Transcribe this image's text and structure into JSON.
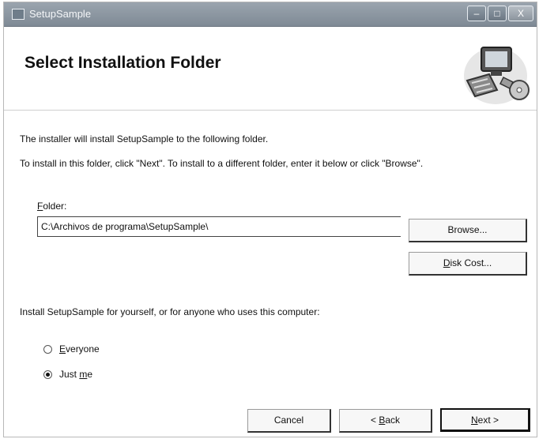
{
  "window": {
    "title": "SetupSample",
    "minimize_glyph": "–",
    "maximize_glyph": "□",
    "close_glyph": "X"
  },
  "header": {
    "title": "Select Installation Folder",
    "graphic_icon": "computer-setup-icon"
  },
  "body": {
    "line1": "The installer will install SetupSample to the following folder.",
    "line2": "To install in this folder, click \"Next\". To install to a different folder, enter it below or click \"Browse\"."
  },
  "folder": {
    "label_mnemonic": "F",
    "label_rest": "older:",
    "value": "C:\\Archivos de programa\\SetupSample\\"
  },
  "buttons": {
    "browse": "Browse...",
    "disk_cost_mnemonic": "D",
    "disk_cost_rest": "isk Cost...",
    "cancel": "Cancel",
    "back_prefix": "< ",
    "back_mnemonic": "B",
    "back_rest": "ack",
    "next_mnemonic": "N",
    "next_rest": "ext >"
  },
  "install_for": {
    "prompt": "Install SetupSample for yourself, or for anyone who uses this computer:",
    "everyone_mnemonic": "E",
    "everyone_rest": "veryone",
    "justme_prefix": "Just ",
    "justme_mnemonic": "m",
    "justme_rest": "e",
    "selected": "just_me"
  }
}
